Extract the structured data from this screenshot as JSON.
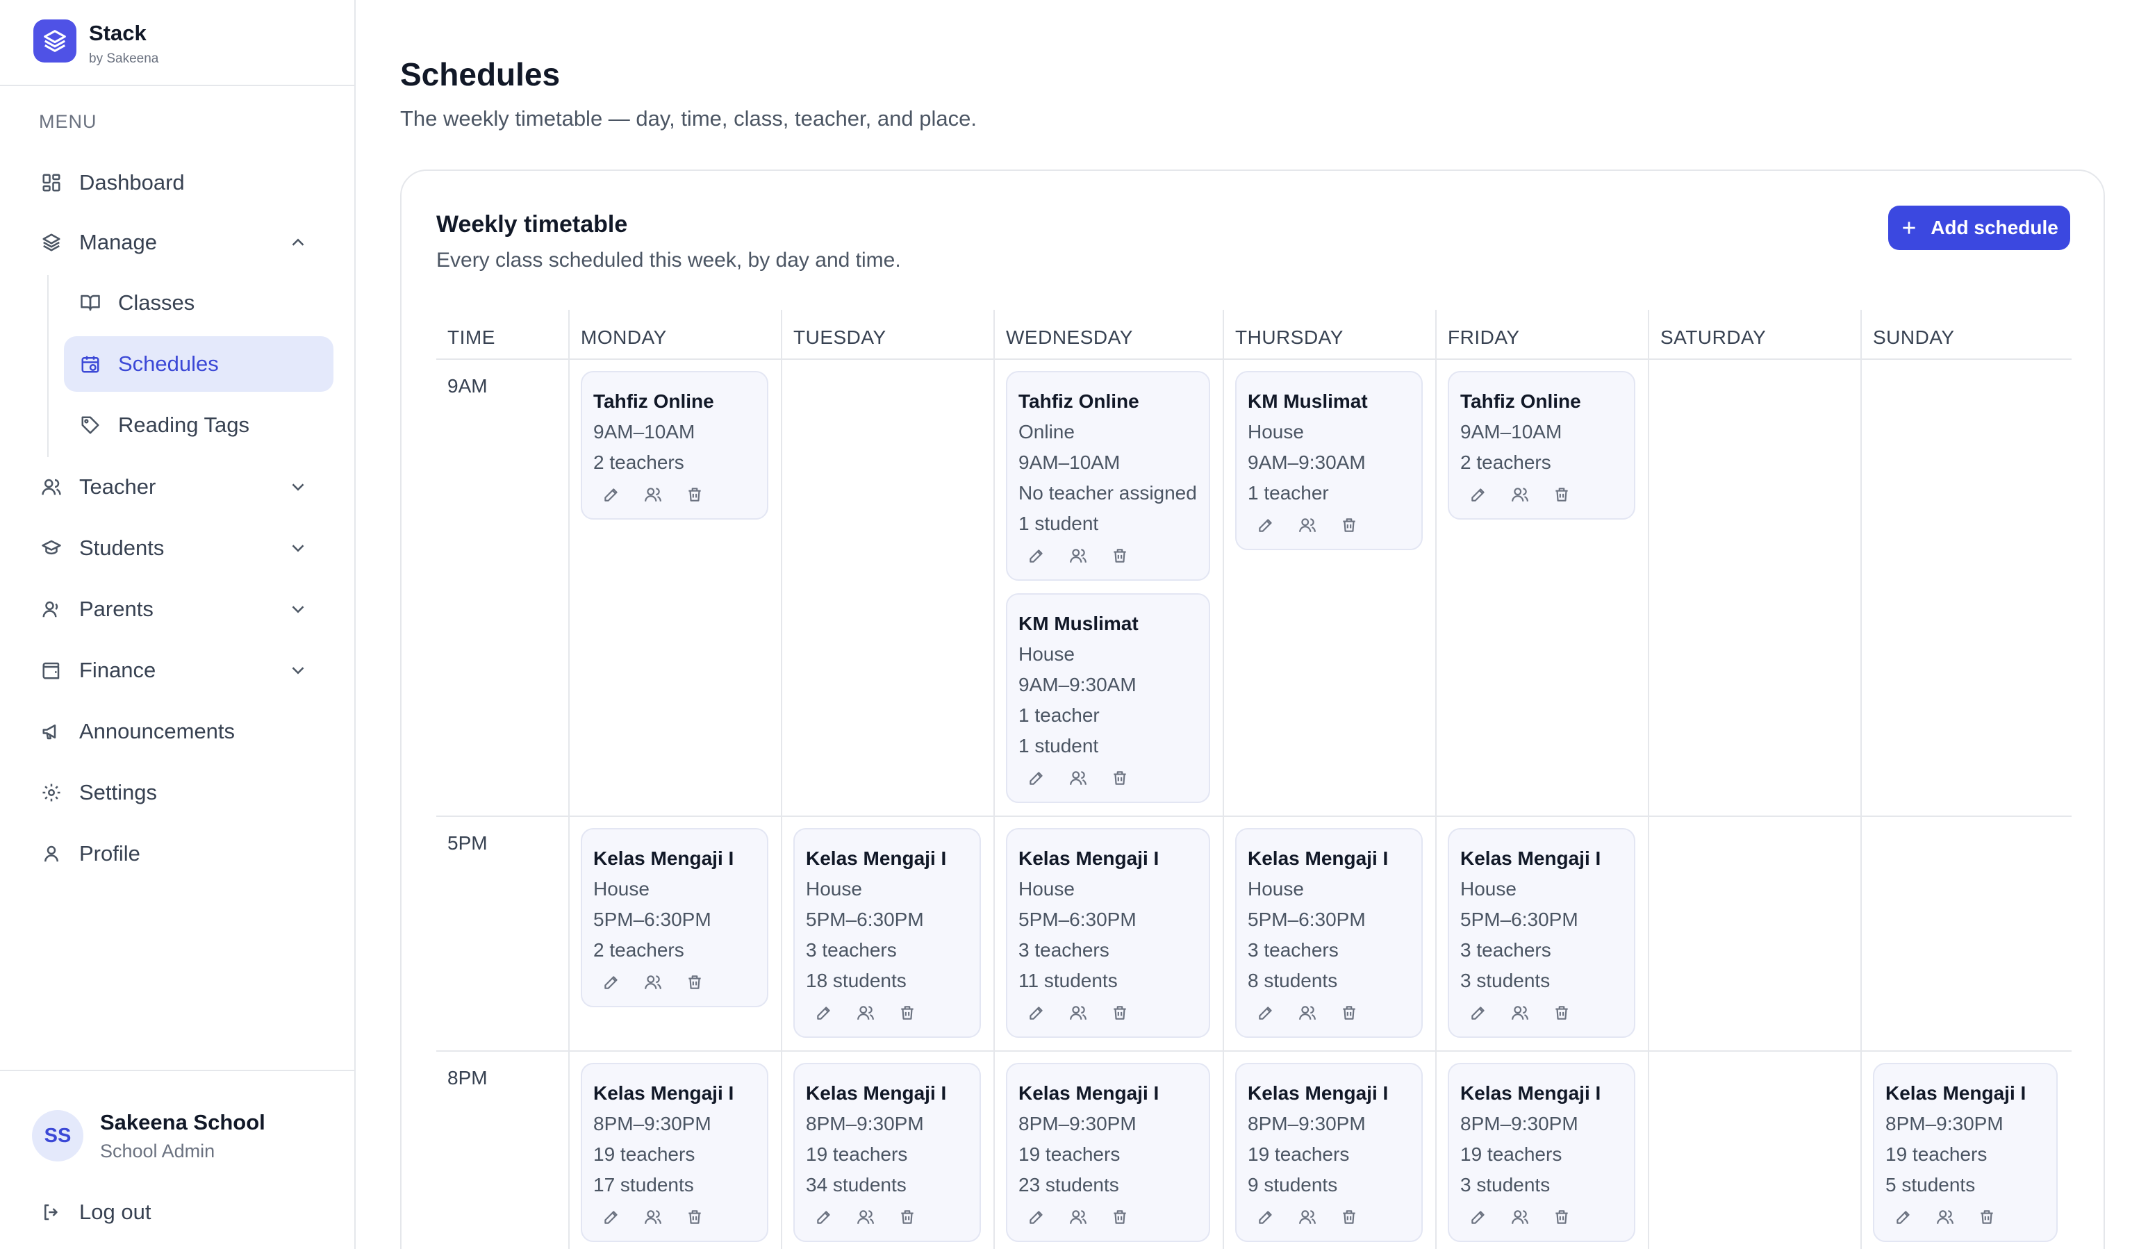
{
  "brand": {
    "name": "Stack",
    "sub": "by Sakeena"
  },
  "menu_label": "MENU",
  "nav": {
    "dashboard": "Dashboard",
    "manage": "Manage",
    "classes": "Classes",
    "schedules": "Schedules",
    "reading_tags": "Reading Tags",
    "teacher": "Teacher",
    "students": "Students",
    "parents": "Parents",
    "finance": "Finance",
    "announcements": "Announcements",
    "settings": "Settings",
    "profile": "Profile"
  },
  "user": {
    "initials": "SS",
    "name": "Sakeena School",
    "role": "School Admin",
    "logout": "Log out"
  },
  "page": {
    "title": "Schedules",
    "subtitle": "The weekly timetable — day, time, class, teacher, and place."
  },
  "card": {
    "title": "Weekly timetable",
    "subtitle": "Every class scheduled this week, by day and time.",
    "add_label": "Add schedule"
  },
  "columns": [
    "TIME",
    "MONDAY",
    "TUESDAY",
    "WEDNESDAY",
    "THURSDAY",
    "FRIDAY",
    "SATURDAY",
    "SUNDAY"
  ],
  "times": [
    "9AM",
    "5PM",
    "8PM"
  ],
  "colors": {
    "accent": "#3b48e0",
    "active_bg": "#e4e9fb",
    "card_bg": "#f6f7fd"
  },
  "schedules": [
    {
      "day": "MONDAY",
      "slot": "9AM",
      "title": "Tahfiz Online",
      "lines": [
        "9AM–10AM",
        "2 teachers"
      ]
    },
    {
      "day": "WEDNESDAY",
      "slot": "9AM",
      "title": "Tahfiz Online",
      "lines": [
        "Online",
        "9AM–10AM",
        "No teacher assigned",
        "1 student"
      ]
    },
    {
      "day": "WEDNESDAY",
      "slot": "9AM",
      "title": "KM Muslimat",
      "lines": [
        "House",
        "9AM–9:30AM",
        "1 teacher",
        "1 student"
      ]
    },
    {
      "day": "THURSDAY",
      "slot": "9AM",
      "title": "KM Muslimat",
      "lines": [
        "House",
        "9AM–9:30AM",
        "1 teacher"
      ]
    },
    {
      "day": "FRIDAY",
      "slot": "9AM",
      "title": "Tahfiz Online",
      "lines": [
        "9AM–10AM",
        "2 teachers"
      ]
    },
    {
      "day": "MONDAY",
      "slot": "5PM",
      "title": "Kelas Mengaji I",
      "lines": [
        "House",
        "5PM–6:30PM",
        "2 teachers"
      ]
    },
    {
      "day": "TUESDAY",
      "slot": "5PM",
      "title": "Kelas Mengaji I",
      "lines": [
        "House",
        "5PM–6:30PM",
        "3 teachers",
        "18 students"
      ]
    },
    {
      "day": "WEDNESDAY",
      "slot": "5PM",
      "title": "Kelas Mengaji I",
      "lines": [
        "House",
        "5PM–6:30PM",
        "3 teachers",
        "11 students"
      ]
    },
    {
      "day": "THURSDAY",
      "slot": "5PM",
      "title": "Kelas Mengaji I",
      "lines": [
        "House",
        "5PM–6:30PM",
        "3 teachers",
        "8 students"
      ]
    },
    {
      "day": "FRIDAY",
      "slot": "5PM",
      "title": "Kelas Mengaji I",
      "lines": [
        "House",
        "5PM–6:30PM",
        "3 teachers",
        "3 students"
      ]
    },
    {
      "day": "MONDAY",
      "slot": "8PM",
      "title": "Kelas Mengaji I",
      "lines": [
        "8PM–9:30PM",
        "19 teachers",
        "17 students"
      ]
    },
    {
      "day": "TUESDAY",
      "slot": "8PM",
      "title": "Kelas Mengaji I",
      "lines": [
        "8PM–9:30PM",
        "19 teachers",
        "34 students"
      ]
    },
    {
      "day": "WEDNESDAY",
      "slot": "8PM",
      "title": "Kelas Mengaji I",
      "lines": [
        "8PM–9:30PM",
        "19 teachers",
        "23 students"
      ]
    },
    {
      "day": "THURSDAY",
      "slot": "8PM",
      "title": "Kelas Mengaji I",
      "lines": [
        "8PM–9:30PM",
        "19 teachers",
        "9 students"
      ]
    },
    {
      "day": "FRIDAY",
      "slot": "8PM",
      "title": "Kelas Mengaji I",
      "lines": [
        "8PM–9:30PM",
        "19 teachers",
        "3 students"
      ]
    },
    {
      "day": "SUNDAY",
      "slot": "8PM",
      "title": "Kelas Mengaji I",
      "lines": [
        "8PM–9:30PM",
        "19 teachers",
        "5 students"
      ]
    }
  ]
}
